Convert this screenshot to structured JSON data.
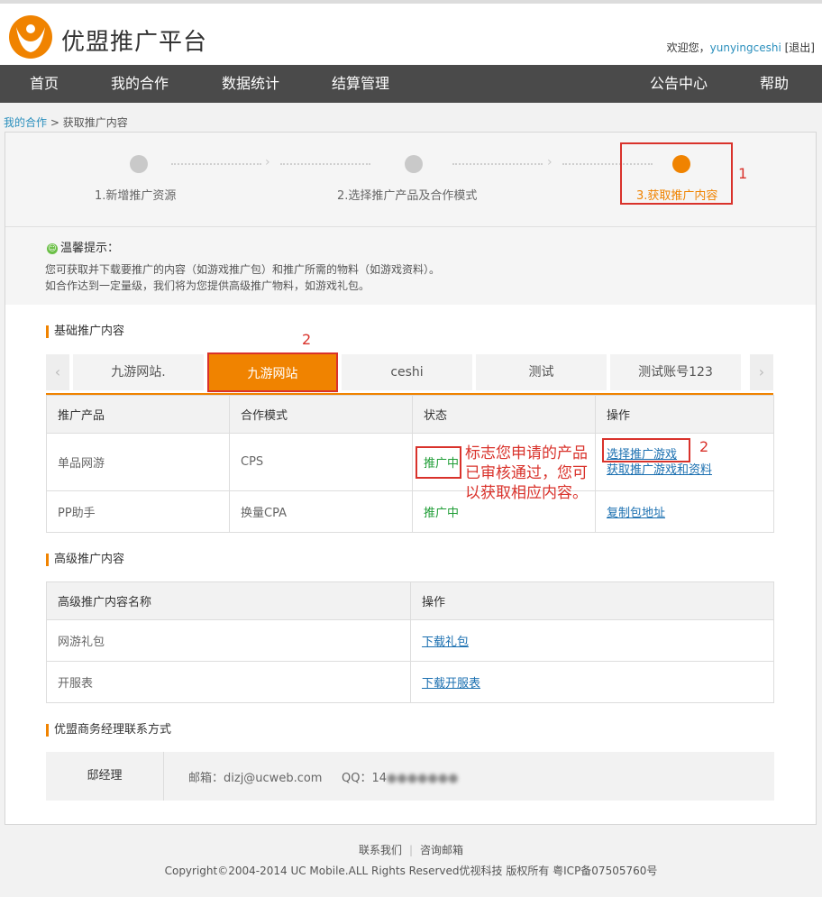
{
  "header": {
    "logo_text": "优盟推广平台",
    "welcome_prefix": "欢迎您，",
    "username": "yunyingceshi",
    "logout": "[退出]"
  },
  "nav": {
    "items": [
      "首页",
      "我的合作",
      "数据统计",
      "结算管理"
    ],
    "right_items": [
      "公告中心",
      "帮助"
    ]
  },
  "breadcrumb": {
    "parent": "我的合作",
    "separator": ">",
    "current": "获取推广内容"
  },
  "steps": {
    "items": [
      "1.新增推广资源",
      "2.选择推广产品及合作模式",
      "3.获取推广内容"
    ],
    "active_index": 2,
    "annotation": "1"
  },
  "tips": {
    "title": "温馨提示：",
    "lines": [
      "您可获取并下载要推广的内容（如游戏推广包）和推广所需的物料（如游戏资料）。",
      "如合作达到一定量级，我们将为您提供高级推广物料，如游戏礼包。"
    ]
  },
  "basic": {
    "title": "基础推广内容",
    "annotation": "2",
    "tabs": [
      "九游网站.",
      "九游网站",
      "ceshi",
      "测试",
      "测试账号123"
    ],
    "active_tab": 1,
    "columns": [
      "推广产品",
      "合作模式",
      "状态",
      "操作"
    ],
    "rows": [
      {
        "product": "单品网游",
        "mode": "CPS",
        "status": "推广中",
        "actions": [
          "选择推广游戏",
          "获取推广游戏和资料"
        ]
      },
      {
        "product": "PP助手",
        "mode": "换量CPA",
        "status": "推广中",
        "actions": [
          "复制包地址"
        ]
      }
    ],
    "note": [
      "标志您申请的产品",
      "已审核通过，您可",
      "以获取相应内容。"
    ],
    "action_annotation": "2"
  },
  "advanced": {
    "title": "高级推广内容",
    "columns": [
      "高级推广内容名称",
      "操作"
    ],
    "rows": [
      {
        "name": "网游礼包",
        "action": "下载礼包"
      },
      {
        "name": "开服表",
        "action": "下载开服表"
      }
    ]
  },
  "contact": {
    "title": "优盟商务经理联系方式",
    "name": "邸经理",
    "email": "邮箱：dizj@ucweb.com",
    "qq_label": "QQ：",
    "qq_value": "14"
  },
  "footer": {
    "links": [
      "联系我们",
      "咨询邮箱"
    ],
    "copyright": "Copyright©2004-2014 UC Mobile.ALL Rights Reserved优视科技 版权所有 粤ICP备07505760号"
  },
  "colors": {
    "accent": "#f08300",
    "nav_bg": "#4a4a4a",
    "annotation_red": "#d9322b",
    "status_green": "#1f9d36",
    "link_blue": "#1a6fb0"
  }
}
